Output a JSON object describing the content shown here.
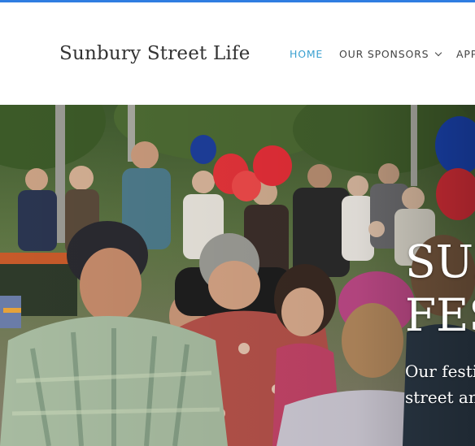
{
  "site": {
    "title": "Sunbury Street Life"
  },
  "nav": {
    "items": [
      {
        "label": "HOME",
        "active": true
      },
      {
        "label": "OUR SPONSORS",
        "has_dropdown": true
      },
      {
        "label": "APP"
      }
    ]
  },
  "hero": {
    "title_line1": "SUN",
    "title_line2": "FES",
    "subtitle_line1": "Our festi",
    "subtitle_line2": "street an"
  },
  "colors": {
    "accent_bar": "#2f7de1",
    "nav_active": "#3aa0d0",
    "nav_text": "#444444"
  }
}
